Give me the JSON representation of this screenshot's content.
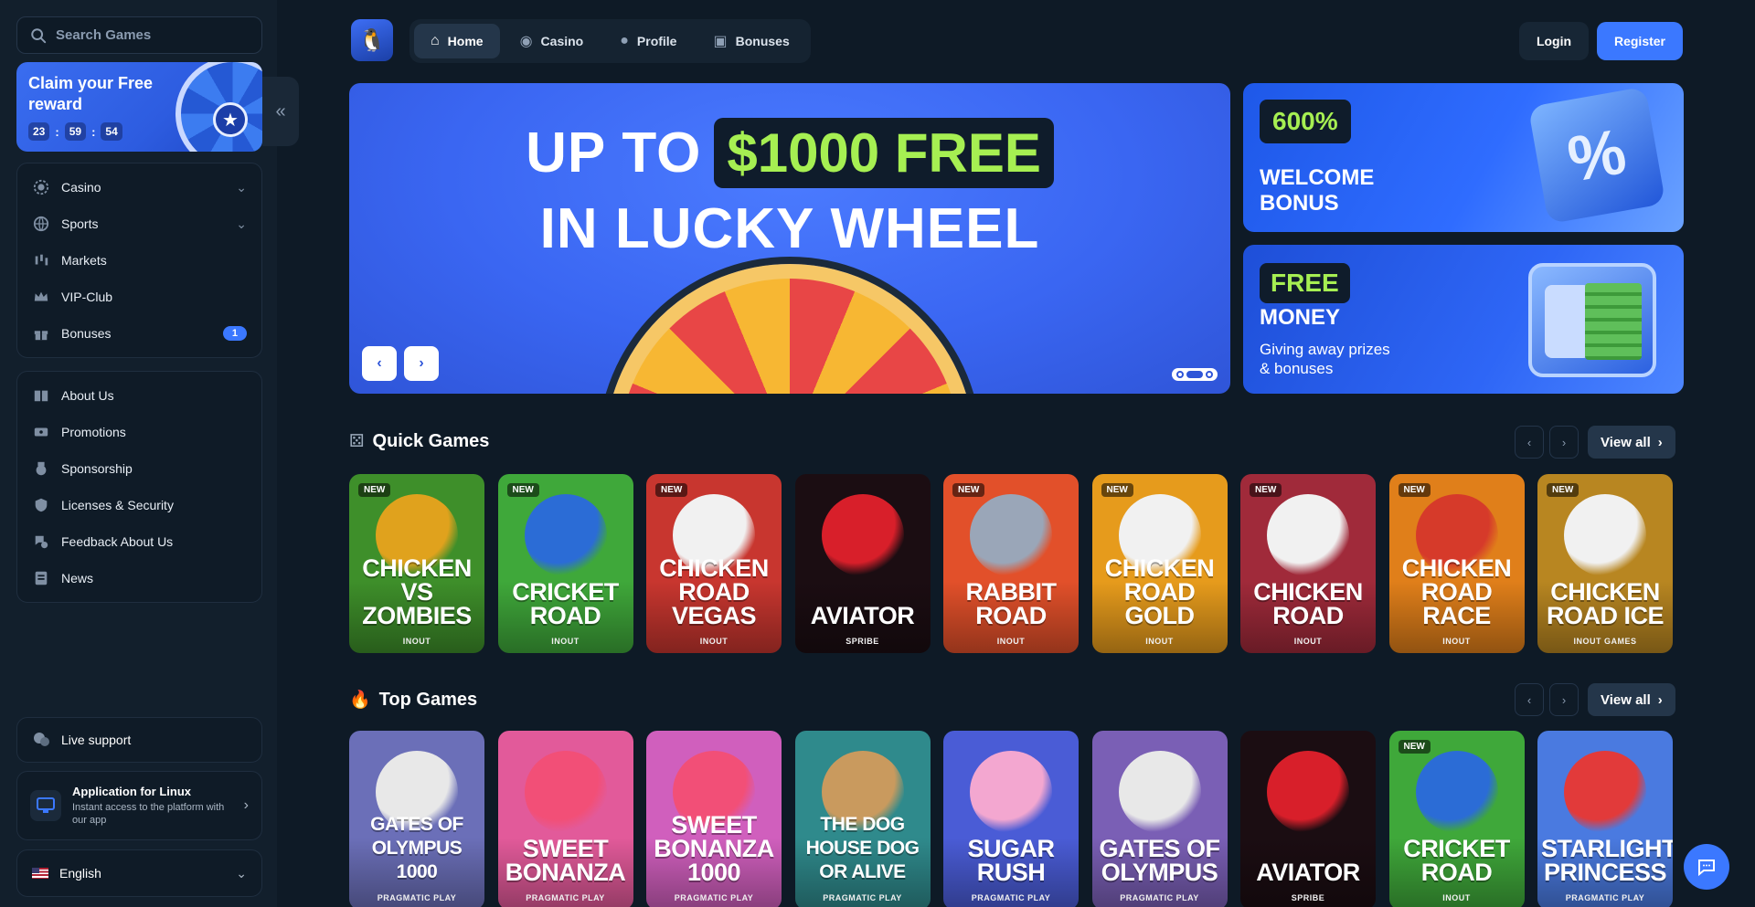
{
  "sidebar": {
    "search_placeholder": "Search Games",
    "reward": {
      "title": "Claim your Free reward",
      "hours": "23",
      "minutes": "59",
      "seconds": "54"
    },
    "menu_main": [
      {
        "label": "Casino",
        "icon": "casino-chip-icon",
        "expandable": true
      },
      {
        "label": "Sports",
        "icon": "globe-icon",
        "expandable": true
      },
      {
        "label": "Markets",
        "icon": "candles-icon",
        "expandable": false
      },
      {
        "label": "VIP-Club",
        "icon": "crown-icon",
        "expandable": false
      },
      {
        "label": "Bonuses",
        "icon": "gift-icon",
        "expandable": false,
        "badge": "1"
      }
    ],
    "menu_info": [
      {
        "label": "About Us",
        "icon": "book-icon"
      },
      {
        "label": "Promotions",
        "icon": "ticket-icon"
      },
      {
        "label": "Sponsorship",
        "icon": "medal-icon"
      },
      {
        "label": "Licenses & Security",
        "icon": "shield-icon"
      },
      {
        "label": "Feedback About Us",
        "icon": "feedback-icon"
      },
      {
        "label": "News",
        "icon": "news-icon"
      }
    ],
    "support_label": "Live support",
    "app": {
      "title": "Application for Linux",
      "subtitle": "Instant access to the platform with our app"
    },
    "language": "English"
  },
  "header": {
    "nav": [
      {
        "label": "Home",
        "icon": "home-icon",
        "active": true
      },
      {
        "label": "Casino",
        "icon": "chip-icon",
        "active": false
      },
      {
        "label": "Profile",
        "icon": "user-icon",
        "active": false
      },
      {
        "label": "Bonuses",
        "icon": "gift-icon",
        "active": false
      }
    ],
    "login_label": "Login",
    "register_label": "Register"
  },
  "hero": {
    "line1_prefix": "UP TO",
    "line1_amount": "$1000 FREE",
    "line2": "IN LUCKY WHEEL",
    "slide_count": 3,
    "active_slide": 2
  },
  "promos": [
    {
      "badge": "600%",
      "title": "WELCOME BONUS",
      "subtitle": ""
    },
    {
      "badge": "FREE",
      "title": "MONEY",
      "subtitle": "Giving away prizes & bonuses"
    }
  ],
  "sections": {
    "quick": {
      "title": "Quick Games",
      "view_all": "View all"
    },
    "top": {
      "title": "Top Games",
      "view_all": "View all"
    }
  },
  "quick_games": [
    {
      "name": "CHICKEN VS ZOMBIES",
      "provider": "INOUT",
      "new": true,
      "bg": "#3e8f2a",
      "art": "#e0a21d"
    },
    {
      "name": "CRICKET ROAD",
      "provider": "INOUT",
      "new": true,
      "bg": "#3fa83a",
      "art": "#2b6cd6"
    },
    {
      "name": "CHICKEN ROAD VEGAS",
      "provider": "INOUT",
      "new": true,
      "bg": "#c8362f",
      "art": "#f1f1f1"
    },
    {
      "name": "AVIATOR",
      "provider": "SPRIBE",
      "new": false,
      "bg": "#1b0d12",
      "art": "#d81f2a"
    },
    {
      "name": "RABBIT ROAD",
      "provider": "INOUT",
      "new": true,
      "bg": "#e2502a",
      "art": "#9aa6b8"
    },
    {
      "name": "CHICKEN ROAD GOLD",
      "provider": "INOUT",
      "new": true,
      "bg": "#e69b1c",
      "art": "#f1f1f1"
    },
    {
      "name": "CHICKEN ROAD",
      "provider": "INOUT",
      "new": true,
      "bg": "#a02a3a",
      "art": "#f1f1f1"
    },
    {
      "name": "CHICKEN ROAD RACE",
      "provider": "INOUT",
      "new": true,
      "bg": "#e07f1a",
      "art": "#d63a2a"
    },
    {
      "name": "CHICKEN ROAD ICE",
      "provider": "INOUT GAMES",
      "new": true,
      "bg": "#b88621",
      "art": "#f1f1f1"
    }
  ],
  "top_games": [
    {
      "name": "GATES OF OLYMPUS 1000",
      "provider": "PRAGMATIC PLAY",
      "new": false,
      "bg": "#6b6fb8",
      "art": "#e8e8e8"
    },
    {
      "name": "SWEET BONANZA",
      "provider": "PRAGMATIC PLAY",
      "new": false,
      "bg": "#e25a9a",
      "art": "#f24f77"
    },
    {
      "name": "SWEET BONANZA 1000",
      "provider": "PRAGMATIC PLAY",
      "new": false,
      "bg": "#d05fbd",
      "art": "#f24f77"
    },
    {
      "name": "THE DOG HOUSE DOG OR ALIVE",
      "provider": "PRAGMATIC PLAY",
      "new": false,
      "bg": "#2f8a8c",
      "art": "#c99a5e"
    },
    {
      "name": "SUGAR RUSH",
      "provider": "PRAGMATIC PLAY",
      "new": false,
      "bg": "#4a5cd6",
      "art": "#f3a7d0"
    },
    {
      "name": "GATES OF OLYMPUS",
      "provider": "PRAGMATIC PLAY",
      "new": false,
      "bg": "#7a5fb5",
      "art": "#e8e8e8"
    },
    {
      "name": "AVIATOR",
      "provider": "SPRIBE",
      "new": false,
      "bg": "#1b0d12",
      "art": "#d81f2a"
    },
    {
      "name": "CRICKET ROAD",
      "provider": "INOUT",
      "new": true,
      "bg": "#3fa83a",
      "art": "#2b6cd6"
    },
    {
      "name": "STARLIGHT PRINCESS",
      "provider": "PRAGMATIC PLAY",
      "new": false,
      "bg": "#4a7ae0",
      "art": "#e23a3a"
    }
  ],
  "new_badge_label": "NEW",
  "colors": {
    "accent": "#3b78ff",
    "highlight": "#a6ef52",
    "bg": "#0e1a26"
  }
}
